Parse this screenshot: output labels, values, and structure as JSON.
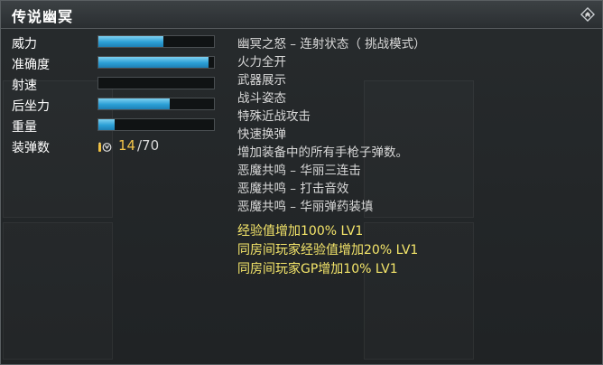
{
  "header": {
    "title": "传说幽冥",
    "corner_icon": "diamond-chevron-icon"
  },
  "stats": [
    {
      "label": "威力",
      "value_percent": 56
    },
    {
      "label": "准确度",
      "value_percent": 95
    },
    {
      "label": "射速",
      "value_percent": 0
    },
    {
      "label": "后坐力",
      "value_percent": 62
    },
    {
      "label": "重量",
      "value_percent": 14
    }
  ],
  "ammo": {
    "label": "装弹数",
    "icon": "bullet-icon",
    "current": "14",
    "total": "/70"
  },
  "features": [
    "幽冥之怒 – 连射状态（ 挑战模式）",
    "火力全开",
    "武器展示",
    "战斗姿态",
    "特殊近战攻击",
    "快速换弹",
    "增加装备中的所有手枪子弹数。",
    "恶魔共鸣 – 华丽三连击",
    "恶魔共鸣 – 打击音效",
    "恶魔共鸣 – 华丽弹药装填"
  ],
  "bonuses": [
    "经验值增加100% LV1",
    "同房间玩家经验值增加20% LV1",
    "同房间玩家GP增加10% LV1"
  ],
  "colors": {
    "bar_fill": "#2b9fd6",
    "ammo_current": "#f3c54a",
    "bonus_text": "#f5e66a",
    "feature_text": "#d9d9d9"
  }
}
